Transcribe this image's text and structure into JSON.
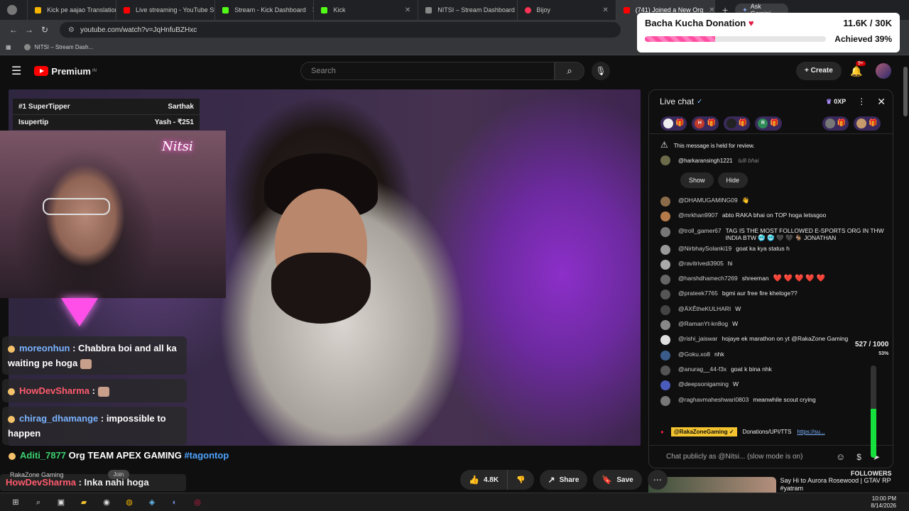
{
  "browser": {
    "tabs": [
      {
        "title": "Kick pe aajao Translation",
        "color": "#f4b400"
      },
      {
        "title": "Live streaming - YouTube Studio",
        "color": "#ff0000"
      },
      {
        "title": "Stream - Kick Dashboard",
        "color": "#53fc18"
      },
      {
        "title": "Kick",
        "color": "#53fc18"
      },
      {
        "title": "NITSI – Stream Dashboard",
        "color": "#888888"
      },
      {
        "title": "Bijoy",
        "color": "#ff3355"
      },
      {
        "title": "(741) Joined a New Org",
        "color": "#ff0000"
      }
    ],
    "ask_gemini": "Ask Gemini",
    "url": "youtube.com/watch?v=JqHnfuBZHxc",
    "bookmark": "NITSI – Stream Dash..."
  },
  "donation": {
    "title": "Bacha Kucha Donation",
    "amount": "11.6K / 30K",
    "achieved": "Achieved 39%",
    "progress": 0.39
  },
  "youtube": {
    "brand": "Premium",
    "region": "IN",
    "search_placeholder": "Search",
    "create_label": "Create",
    "notif_count": "9+"
  },
  "overlay": {
    "supertipper_label": "#1 SuperTipper",
    "supertipper_name": "Sarthak",
    "supertip_label": "Isupertip",
    "supertip_value": "Yash - ₹251",
    "cam_sign": "Nitsi",
    "chat": [
      {
        "user": "moreonhun",
        "text": " : Chabbra boi and all ka waiting pe hoga"
      },
      {
        "user": "HowDevSharma",
        "text": " :"
      },
      {
        "user": "chirag_dhamange",
        "text": " : impossible to happen"
      }
    ],
    "ticker_user": "Aditi_7877",
    "ticker_text": "Org TEAM APEX GAMING",
    "ticker_tag": "#tagontop",
    "channel": "RakaZone Gaming",
    "join": "Join",
    "last_user": "HowDevSharma",
    "last_text": " : Inka nahi hoga"
  },
  "actions": {
    "likes": "4.8K",
    "share": "Share",
    "save": "Save"
  },
  "chat": {
    "title": "Live chat",
    "xp": "0XP",
    "gifts": [
      "H",
      "R"
    ],
    "held_notice": "This message is held for review.",
    "held_user": "@harkaransingh1221",
    "held_text": "lulli bhai",
    "show": "Show",
    "hide": "Hide",
    "messages": [
      {
        "user": "@DHAMUGAMING09",
        "text": "👋",
        "color": "#8b6b4a"
      },
      {
        "user": "@mrkhan9907",
        "text": "abto RAKA bhai on TOP hoga letssgoo",
        "color": "#b57a4a"
      },
      {
        "user": "@troll_gamer67",
        "text": "TAG IS THE MOST FOLLOWED E-SPORTS ORG IN THW INDIA BTW 🥶 🥶 🖤 🖤 🐐 JONATHAN",
        "color": "#777777"
      },
      {
        "user": "@NirbhaySolanki19",
        "text": "goat ka kya status h",
        "color": "#999999"
      },
      {
        "user": "@ravitrivedi3905",
        "text": "hi",
        "color": "#aaaaaa"
      },
      {
        "user": "@harshdhamech7269",
        "text": "shreeman",
        "hearts": "❤️ ❤️ ❤️ ❤️ ❤️",
        "color": "#666666"
      },
      {
        "user": "@prateek7765",
        "text": "bgmi aur free fire kheloge??",
        "color": "#555555"
      },
      {
        "user": "@ÄXÊtheKULHARI",
        "text": "W",
        "color": "#444444"
      },
      {
        "user": "@RamanYt-kn8og",
        "text": "W",
        "color": "#888888"
      },
      {
        "user": "@rishi_jaiswar",
        "text": "hojaye ek marathon on yt @RakaZone Gaming",
        "color": "#e0e0e0"
      },
      {
        "user": "@Goku.xo8",
        "text": "nhk",
        "color": "#3b5b8b"
      },
      {
        "user": "@anurag__44-f3x",
        "text": "goat k bina nhk",
        "color": "#555555"
      },
      {
        "user": "@deepsonigaming",
        "text": "W",
        "color": "#4b5bbb"
      },
      {
        "user": "@raghavmaheshwari0803",
        "text": "meanwhile scout crying",
        "color": "#777777"
      }
    ],
    "pinned_badge": "@RakaZoneGaming ✓",
    "pinned_text": "Donations/UPI/TTS",
    "pinned_link": "https://su...",
    "input_placeholder": "Chat publicly as @Nitsi... (slow mode is on)"
  },
  "goal": {
    "count": "527 / 1000",
    "pct": "53%",
    "progress": 0.53,
    "followers": "FOLLOWERS"
  },
  "suggestion": {
    "title": "Say Hi to Aurora Rosewood | GTAV RP #yatram"
  },
  "clock": {
    "time": "10:00 PM",
    "date": "8/14/2026"
  }
}
